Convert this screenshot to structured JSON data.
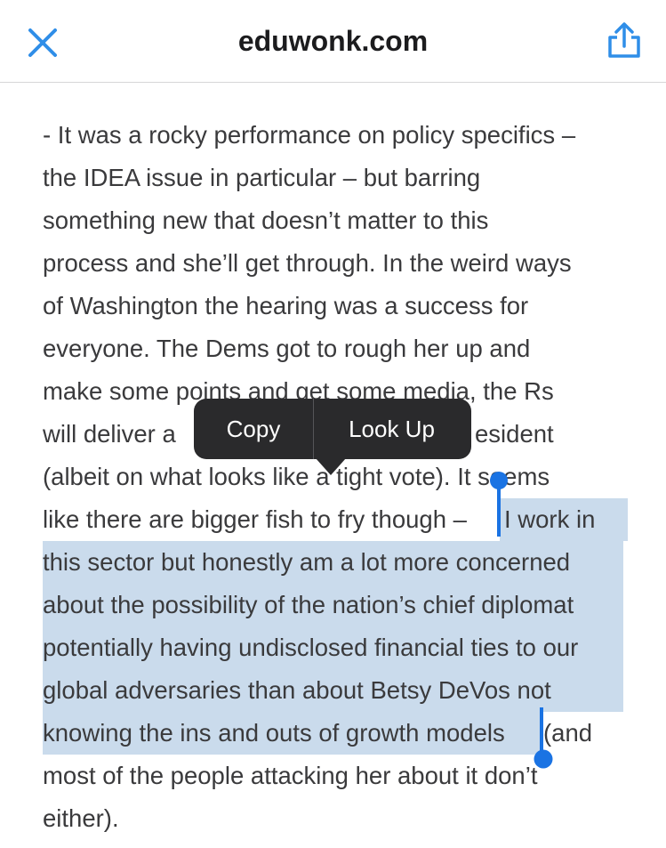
{
  "header": {
    "title": "eduwonk.com",
    "close_icon": "close-x-icon",
    "share_icon": "share-icon",
    "accent_color": "#2f8ee8"
  },
  "article": {
    "lines": [
      "- It was a rocky performance on policy specifics –",
      "the IDEA issue in particular – but barring",
      "something new that doesn’t matter to this",
      "process and she’ll get through. In the weird ways",
      "of Washington the hearing was a success for",
      "everyone. The Dems got to rough her up and",
      "make some points and get some media, the Rs",
      "will deliver a",
      "esident",
      "(albeit on what looks like a tight vote). It seems",
      "like there are bigger fish to fry though – ",
      "I work in",
      "this sector but honestly am a lot more concerned",
      "about the possibility of the nation’s chief diplomat",
      "potentially having undisclosed financial ties to our",
      "global adversaries than about Betsy DeVos not",
      "knowing the ins and outs of growth models",
      " (and",
      "most of the people attacking her about it don’t",
      "either)."
    ]
  },
  "context_menu": {
    "copy_label": "Copy",
    "lookup_label": "Look Up"
  },
  "selection_color": "#cadbec"
}
